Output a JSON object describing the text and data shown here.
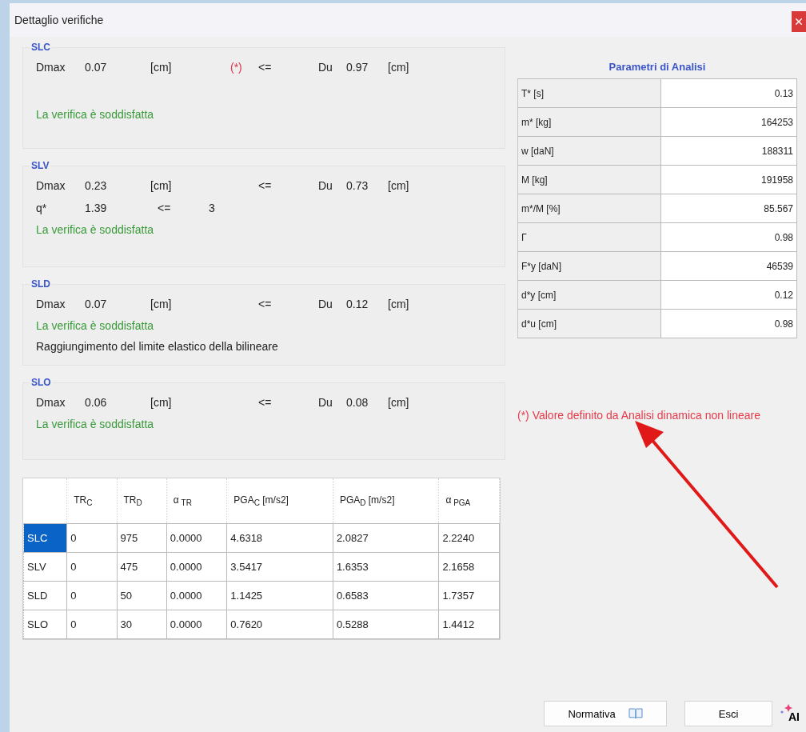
{
  "window": {
    "title": "Dettaglio verifiche"
  },
  "checks": [
    {
      "name": "SLC",
      "dmax_label": "Dmax",
      "dmax": "0.07",
      "dmax_unit": "[cm]",
      "marker": "(*)",
      "op": "<=",
      "du_label": "Du",
      "du": "0.97",
      "du_unit": "[cm]",
      "status": "La verifica è soddisfatta"
    },
    {
      "name": "SLV",
      "dmax_label": "Dmax",
      "dmax": "0.23",
      "dmax_unit": "[cm]",
      "op": "<=",
      "du_label": "Du",
      "du": "0.73",
      "du_unit": "[cm]",
      "q": {
        "label": "q*",
        "value": "1.39",
        "op": "<=",
        "limit": "3"
      },
      "status": "La verifica è soddisfatta"
    },
    {
      "name": "SLD",
      "dmax_label": "Dmax",
      "dmax": "0.07",
      "dmax_unit": "[cm]",
      "op": "<=",
      "du_label": "Du",
      "du": "0.12",
      "du_unit": "[cm]",
      "status": "La verifica è soddisfatta",
      "note": "Raggiungimento del limite elastico della bilineare"
    },
    {
      "name": "SLO",
      "dmax_label": "Dmax",
      "dmax": "0.06",
      "dmax_unit": "[cm]",
      "op": "<=",
      "du_label": "Du",
      "du": "0.08",
      "du_unit": "[cm]",
      "status": "La verifica è soddisfatta"
    }
  ],
  "results_table": {
    "columns": [
      "",
      "TR$_{C}$",
      "TR$_{D}$",
      "α$_{ TR}$",
      "PGA$_{C}$ [m/s2]",
      "PGA$_{D}$ [m/s2]",
      "α$_{ PGA}$"
    ],
    "rows": [
      {
        "selected": true,
        "cells": [
          "SLC",
          "0",
          "975",
          "0.0000",
          "4.6318",
          "2.0827",
          "2.2240"
        ]
      },
      {
        "selected": false,
        "cells": [
          "SLV",
          "0",
          "475",
          "0.0000",
          "3.5417",
          "1.6353",
          "2.1658"
        ]
      },
      {
        "selected": false,
        "cells": [
          "SLD",
          "0",
          "50",
          "0.0000",
          "1.1425",
          "0.6583",
          "1.7357"
        ]
      },
      {
        "selected": false,
        "cells": [
          "SLO",
          "0",
          "30",
          "0.0000",
          "0.7620",
          "0.5288",
          "1.4412"
        ]
      }
    ]
  },
  "parameters": {
    "title": "Parametri di Analisi",
    "rows": [
      {
        "label": "T* [s]",
        "value": "0.13"
      },
      {
        "label": "m* [kg]",
        "value": "164253"
      },
      {
        "label": "w [daN]",
        "value": "188311"
      },
      {
        "label": "M [kg]",
        "value": "191958"
      },
      {
        "label": "m*/M [%]",
        "value": "85.567"
      },
      {
        "label": "Γ",
        "value": "0.98"
      },
      {
        "label": "F*y [daN]",
        "value": "46539"
      },
      {
        "label": "d*y [cm]",
        "value": "0.12"
      },
      {
        "label": "d*u [cm]",
        "value": "0.98"
      }
    ]
  },
  "footnote": "(*) Valore definito da Analisi dinamica non lineare",
  "buttons": [
    {
      "kind": "book",
      "label": "Normativa"
    },
    {
      "kind": "plain",
      "label": "Esci"
    }
  ],
  "ai_label": "AI"
}
